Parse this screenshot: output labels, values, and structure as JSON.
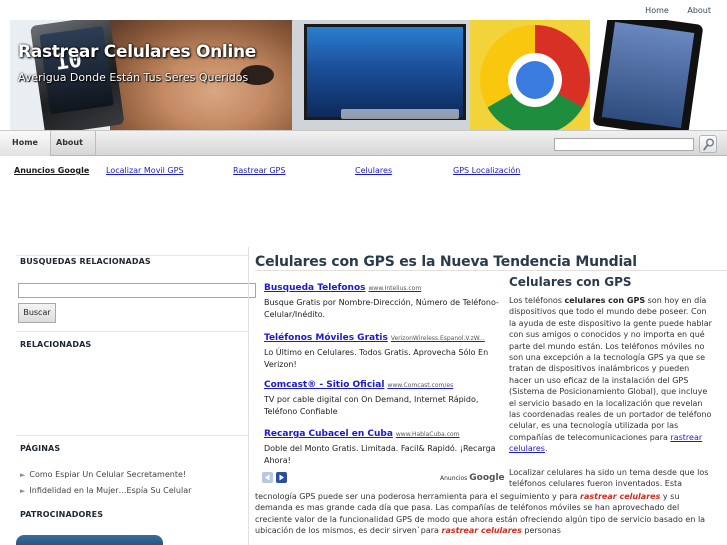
{
  "top_links": [
    "Home",
    "About"
  ],
  "header": {
    "title": "Rastrear Celulares Online",
    "tagline": "Averigua Donde Están Tus Seres Queridos",
    "phone_clock": "10"
  },
  "nav": {
    "items": [
      "Home",
      "About"
    ]
  },
  "ad_links": {
    "label": "Anuncios Google",
    "links": [
      "Localizar Movil GPS",
      "Rastrear GPS",
      "Celulares",
      "GPS Localización"
    ]
  },
  "sidebar": {
    "busquedas_title": "BUSQUEDAS RELACIONADAS",
    "search_button": "Buscar",
    "relacionadas_title": "RELACIONADAS",
    "paginas_title": "PÁGINAS",
    "pages": [
      "Como Espiar Un Celular Secretamente!",
      "Infidelidad en la Mujer…Espía Su Celular"
    ],
    "patrocinadores_title": "PATROCINADORES"
  },
  "main": {
    "title": "Celulares con GPS es la Nueva Tendencia Mundial",
    "ads": [
      {
        "title": "Busqueda Telefonos",
        "url": "www.Intelius.com",
        "desc": "Busque Gratis por Nombre-Dirección, Número de Teléfono-Celular/Inédito."
      },
      {
        "title": "Teléfonos Móviles Gratis",
        "url": "VerizonWireless.Espanol.V.zW...",
        "desc": "Lo Último en Celulares. Todos Gratis. Aprovecha Sólo En Verizon!"
      },
      {
        "title": "Comcast® - Sitio Oficial",
        "url": "www.Comcast.com/es",
        "desc": "TV por cable digital con On Demand, Internet Rápido, Teléfono Confiable"
      },
      {
        "title": "Recarga Cubacel en Cuba",
        "url": "www.HablaCuba.com",
        "desc": "Doble del Monto Gratis. Limitada. Facil& Rapidó. ¡Recarga Ahora!"
      }
    ],
    "anuncios_label": "Anuncios",
    "anuncios_brand": "Google",
    "article_title": "Celulares con GPS",
    "p1_a": "Los teléfonos ",
    "p1_bold": "celulares con GPS",
    "p1_b": " son hoy en día dispositivos que todo el mundo debe poseer. Con la ayuda de este dispositivo la gente puede hablar con sus amigos o conocidos y no importa en qué parte del mundo están. Los teléfonos móviles no son una excepción a la tecnología GPS ya que se tratan de dispositivos inalámbricos y pueden hacer un uso eficaz de la instalación del GPS (Sistema de Posicionamiento Global), que incluye el servicio basado en la localización que revelan las coordenadas reales de un portador de teléfono celular, es una tecnología utilizada por las compañías de telecomunicaciones para ",
    "p1_link": "rastrear celulares",
    "p1_end": ".",
    "p2": "Localizar celulares ha sido un tema desde que los teléfonos celulares fueron inventados. Esta",
    "p3_a": "tecnología GPS puede ser una poderosa herramienta para el seguimiento y para ",
    "p3_em1": "rastrear celulares",
    "p3_b": " y su demanda es mas grande cada día que pasa. Las compañías de teléfonos móviles se han aprovechado del creciente valor de la funcionalidad GPS de modo que ahora están ofreciendo algún tipo de servicio basado en la ubicación de los mismos, es decir sirven`para ",
    "p3_em2": "rastrear celulares",
    "p3_c": " personas"
  }
}
